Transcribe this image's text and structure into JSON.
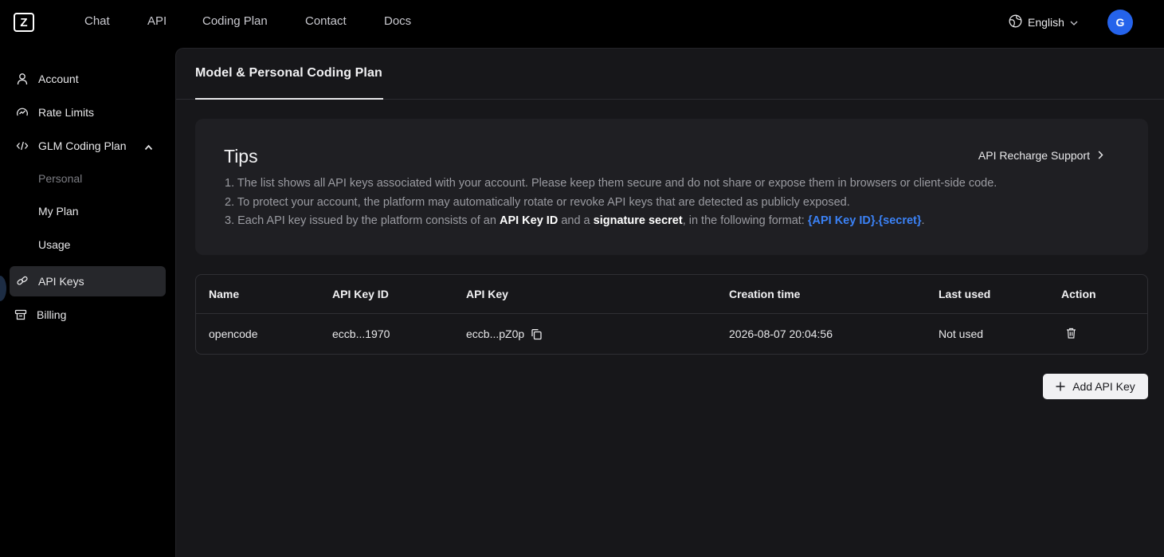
{
  "logo": {
    "letter": "Z"
  },
  "nav": {
    "links": [
      "Chat",
      "API",
      "Coding Plan",
      "Contact",
      "Docs"
    ],
    "language": "English",
    "avatar_initial": "G"
  },
  "sidebar": {
    "items": [
      {
        "label": "Account",
        "icon": "user-icon"
      },
      {
        "label": "Rate Limits",
        "icon": "gauge-icon"
      },
      {
        "label": "GLM Coding Plan",
        "icon": "code-icon",
        "expanded": true
      },
      {
        "label": "Personal",
        "icon": ""
      },
      {
        "label": "My Plan",
        "icon": ""
      },
      {
        "label": "Usage",
        "icon": ""
      },
      {
        "label": "API Keys",
        "icon": "key-icon",
        "active": true
      },
      {
        "label": "Billing",
        "icon": "billing-icon"
      }
    ]
  },
  "main": {
    "tab": "Model & Personal Coding Plan",
    "tips": {
      "title": "Tips",
      "link": "API Recharge Support",
      "line1": "1. The list shows all API keys associated with your account. Please keep them secure and do not share or expose them in browsers or client-side code.",
      "line2": "2. To protect your account, the platform may automatically rotate or revoke API keys that are detected as publicly exposed.",
      "line3_a": "3. Each API key issued by the platform consists of an ",
      "line3_b": "API Key ID",
      "line3_c": " and a ",
      "line3_d": "signature secret",
      "line3_e": ", in the following format: ",
      "line3_f": "{API Key ID}.{secret}",
      "line3_g": "."
    },
    "table": {
      "headers": [
        "Name",
        "API Key ID",
        "API Key",
        "Creation time",
        "Last used",
        "Action"
      ],
      "rows": [
        {
          "name": "opencode",
          "key_id": "eccb...1970",
          "key": "eccb...pZ0p",
          "created": "2026-08-07 20:04:56",
          "last_used": "Not used"
        }
      ]
    },
    "add_button": "Add API Key"
  },
  "colors": {
    "accent_blue": "#3b82f6",
    "avatar_bg": "#2563eb",
    "panel": "#17171a",
    "card": "#1f1f23"
  }
}
